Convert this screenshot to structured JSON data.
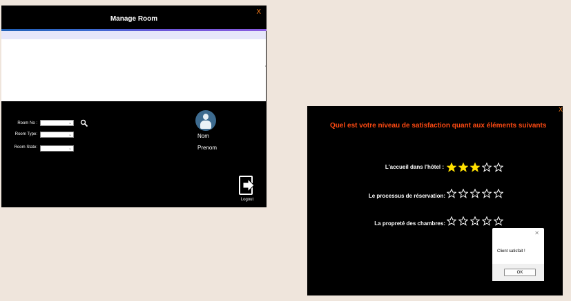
{
  "manage_room": {
    "title": "Manage Room",
    "close_label": "X",
    "form": {
      "room_no_label": "Room No :",
      "room_type_label": "Room Type:",
      "room_state_label": "Room State:",
      "room_no_value": "",
      "room_type_value": "",
      "room_state_value": ""
    },
    "profile": {
      "nom": "Nom",
      "prenom": "Prenom"
    },
    "logout_label": "Logout"
  },
  "satisfaction": {
    "close_label": "X",
    "question": "Quel est votre niveau de satisfaction quant aux éléments suivants",
    "ratings": [
      {
        "label": "L'accueil dans l'hôtel :",
        "value": 3,
        "max": 5
      },
      {
        "label": "Le processus de réservation:",
        "value": 0,
        "max": 5
      },
      {
        "label": "La propreté des chambres:",
        "value": 0,
        "max": 5
      }
    ],
    "colors": {
      "question": "#ff4a12",
      "star_filled": "#ffe000",
      "close": "#ff7f1a"
    }
  },
  "message_box": {
    "text": "Client satisfait !",
    "ok_label": "OK"
  }
}
